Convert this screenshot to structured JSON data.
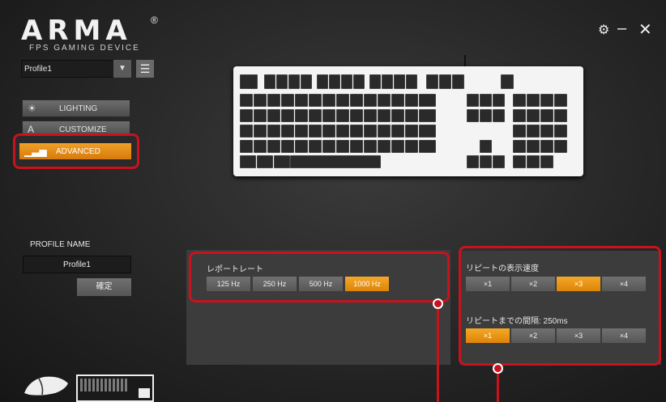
{
  "app": {
    "logo": "ARMA",
    "reg": "®",
    "subtitle": "FPS GAMING DEVICE"
  },
  "window": {
    "settings_icon": "gear-icon",
    "minimize": "–",
    "close": "✕"
  },
  "profile": {
    "selected": "Profile1",
    "dropdown_glyph": "▼",
    "menu_glyph": "☰"
  },
  "tabs": [
    {
      "label": "LIGHTING",
      "icon": "☀"
    },
    {
      "label": "CUSTOMIZE",
      "icon": "A"
    },
    {
      "label": "ADVANCED",
      "icon": "▁▃▅"
    }
  ],
  "profile_name": {
    "label": "PROFILE NAME",
    "value": "Profile1",
    "confirm": "確定"
  },
  "report_rate": {
    "label": "レポートレート",
    "options": [
      "125 Hz",
      "250 Hz",
      "500 Hz",
      "1000 Hz"
    ],
    "selected": "1000 Hz"
  },
  "repeat_speed": {
    "label": "リピートの表示速度",
    "options": [
      "×1",
      "×2",
      "×3",
      "×4"
    ],
    "selected": "×3"
  },
  "repeat_delay": {
    "label": "リピートまでの間隔: 250ms",
    "options": [
      "×1",
      "×2",
      "×3",
      "×4"
    ],
    "selected": "×1"
  },
  "colors": {
    "accent": "#e8900f",
    "highlight": "#c8121d"
  }
}
